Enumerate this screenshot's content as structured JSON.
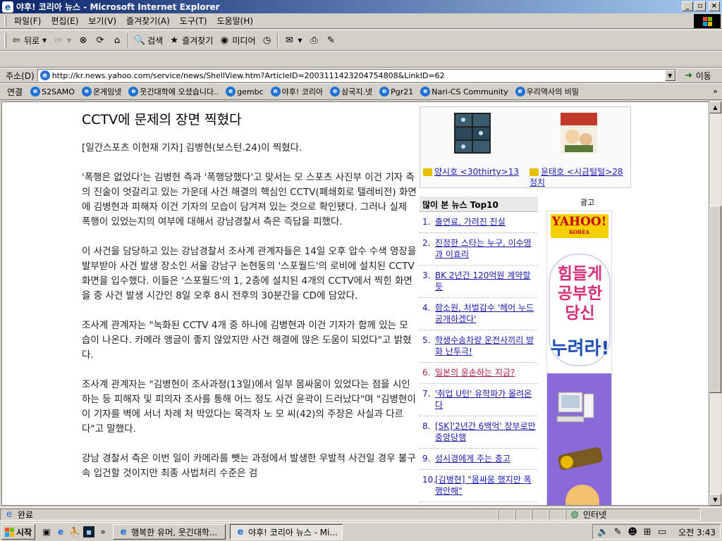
{
  "window": {
    "title": "야후! 코리아 뉴스 - Microsoft Internet Explorer",
    "controls": {
      "minimize": "_",
      "maximize": "▫",
      "close": "×"
    }
  },
  "menu": [
    "파일(F)",
    "편집(E)",
    "보기(V)",
    "즐겨찾기(A)",
    "도구(T)",
    "도움말(H)"
  ],
  "toolbar": {
    "back": "뒤로",
    "search": "검색",
    "favorites": "즐겨찾기",
    "media": "미디어"
  },
  "address": {
    "label": "주소(D)",
    "url": "http://kr.news.yahoo.com/service/news/ShellView.htm?ArticleID=2003111423204754808&LinkID=62",
    "go": "이동"
  },
  "links": {
    "label": "연결",
    "items": [
      "S2SAMO",
      "온게임넷",
      "웃긴대학에 오셨습니다..",
      "gembc",
      "야후! 코리아",
      "삼국지.넷",
      "Pgr21",
      "Nari-CS Community",
      "우리역사의 비밀"
    ]
  },
  "article": {
    "headline": "CCTV에 문제의 장면 찍혔다",
    "paragraphs": [
      "[일간스포츠 이헌재 기자] 김병현(보스턴.24)이 찍혔다.",
      "'폭행은 없었다'는 김병현 측과 '폭행당했다'고 맞서는 모 스포츠 사진부 이건 기자 측의 진술이 엇갈리고 있는 가운데 사건 해결의 핵심인 CCTV(폐쇄회로 텔레비전) 화면에 김병현과 피해자 이건 기자의 모습이 담겨져 있는 것으로 확인됐다. 그러나 실제 폭행이 있었는지의 여부에 대해서 강남경찰서 측은 즉답을 피했다.",
      "이 사건을 담당하고 있는 강남경찰서 조사계 관계자들은 14일 오후 압수 수색 영장을 발부받아 사건 발생 장소인 서울 강남구 논현동의 '스포월드'의 로비에 설치된 CCTV 화면을 입수했다. 이들은 '스포월드'의 1, 2층에 설치된 4개의 CCTV에서 찍힌 화면을 중 사건 발생 시간인 8일 오후 8시 전후의 30분간을 CD에 담았다.",
      "조사계 관계자는 \"녹화된 CCTV 4개 중 하나에 김병현과 이건 기자가 함께 있는 모습이 나온다. 카메라 앵글이 좋지 않았지만 사건 해결에 많은 도움이 되었다\"고 밝혔다.",
      "조사계 관계자는 \"김병현이 조사과정(13일)에서 일부 몸싸움이 있었다는 점을 시인하는 등 피해자 및 피의자 조사를 통해 어느 정도 사건 윤곽이 드러났다\"며 \"김병현이 이 기자를 벽에 서너 차례 처 박았다는 목격자 노 모 씨(42)의 주장은 사실과 다르다\"고 말했다.",
      "강남 경찰서 측은 이번 일이 카메라를 뺏는 과정에서 발생한 우발적 사건일 경우 불구속 입건할 것이지만 최종 사법처리 수준은 검"
    ]
  },
  "sidebar": {
    "thumbs": [
      {
        "caption": "양시호 <30thirty>13"
      },
      {
        "caption": "윤태호 <시금털털>28 정치"
      }
    ],
    "ad_label": "광고",
    "top10": {
      "title": "많이 본 뉴스 Top10",
      "items": [
        {
          "num": "1.",
          "text": "출연료, 가려진 진실"
        },
        {
          "num": "2.",
          "text": "진정한 스타는 누구, 이수영과 이효리"
        },
        {
          "num": "3.",
          "text": "BK 2년간 120억원 계약할 듯"
        },
        {
          "num": "4.",
          "text": "함소원, 처벌감수 '헤어 누드 공개하겠다'"
        },
        {
          "num": "5.",
          "text": "학생수송차량 운전사끼리 방화 난투극!"
        },
        {
          "num": "6.",
          "text": "일본의 윤손하는 지금?"
        },
        {
          "num": "7.",
          "text": "'취업 U턴' 유학파가 몰려온다"
        },
        {
          "num": "8.",
          "text": "[SK]'2년간 6백억' 장부로만 중앙당행"
        },
        {
          "num": "9.",
          "text": "성시경에게 주는 충고"
        },
        {
          "num": "10.",
          "text": "[김병현] \"몸싸움 했지만 폭행안해\""
        }
      ]
    },
    "banner": {
      "logo": "YAHOO!",
      "logo_sub": "KOREA",
      "lines": [
        "힘들게",
        "공부한",
        "당신",
        "누려라!"
      ]
    }
  },
  "status": {
    "text": "완료",
    "zone": "인터넷"
  },
  "taskbar": {
    "start": "시작",
    "windows": [
      "행복한 유머, 웃긴대학...",
      "야후! 코리아 뉴스 - Mi..."
    ],
    "clock": "오전 3:43"
  },
  "colors": {
    "titlebar": "#0a246a",
    "link": "#1b1bb0",
    "chrome": "#d4d0c8"
  }
}
